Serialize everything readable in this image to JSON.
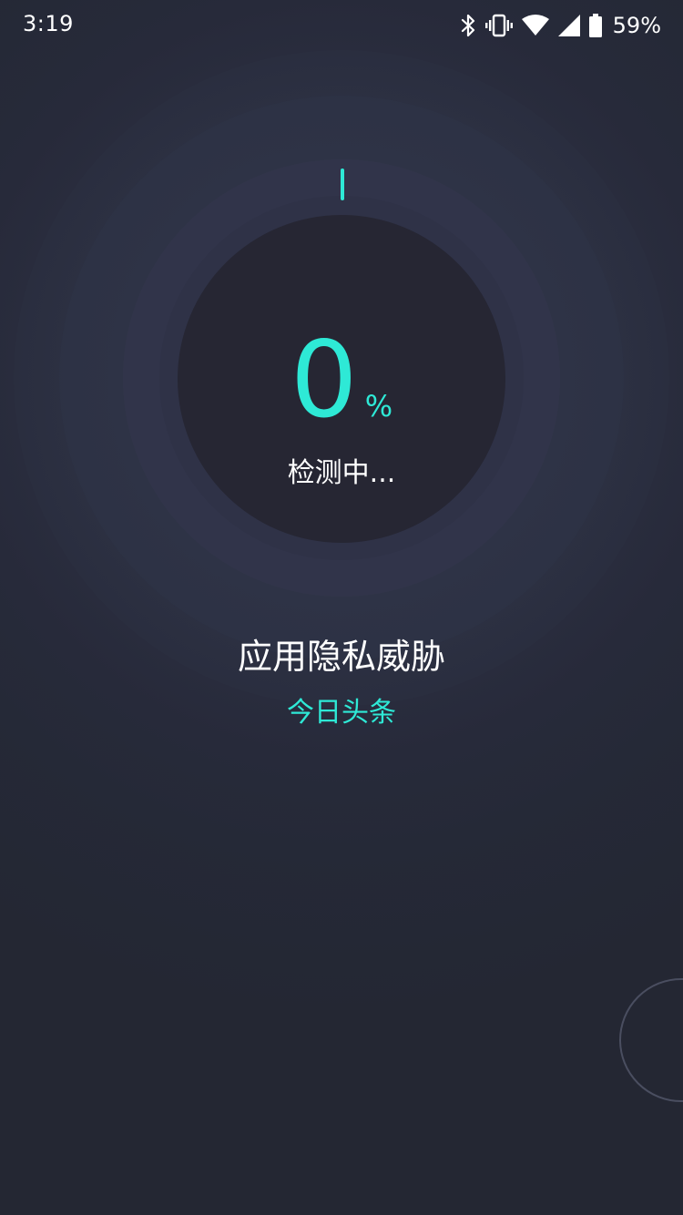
{
  "status_bar": {
    "time": "3:19",
    "battery_percent": "59%",
    "icons": [
      "bluetooth-icon",
      "vibrate-icon",
      "wifi-icon",
      "signal-icon",
      "battery-icon"
    ]
  },
  "scan": {
    "progress_value": "0",
    "percent_sign": "%",
    "status_text": "检测中...",
    "title": "应用隐私威胁",
    "current_app": "今日头条"
  },
  "colors": {
    "background": "#242733",
    "dial": "#262633",
    "accent": "#2ee9d6",
    "text": "#ffffff"
  }
}
